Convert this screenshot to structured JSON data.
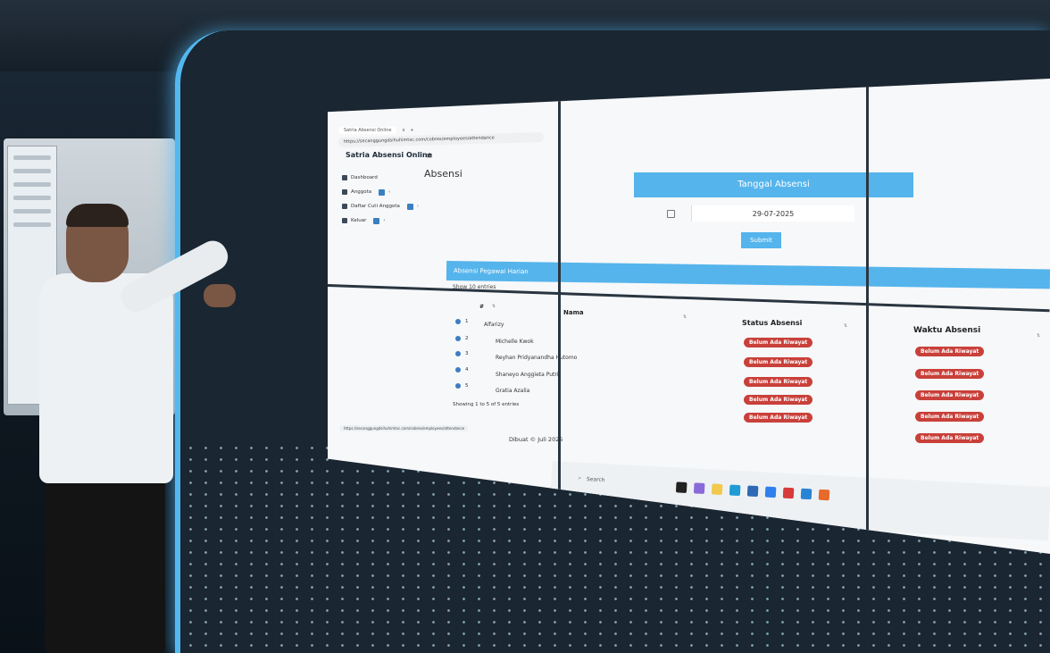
{
  "browser": {
    "tab_label": "Satria Absensi Online",
    "new_tab": "+",
    "close": "x",
    "url": "https://secanggungdsihuhimtxc.com/cobrex/employees/attendance"
  },
  "sidebar": {
    "brand": "Satria Absensi Online",
    "items": [
      {
        "label": "Dashboard"
      },
      {
        "label": "Anggota"
      },
      {
        "label": "Daftar Cuti Anggota"
      },
      {
        "label": "Keluar"
      }
    ]
  },
  "header": {
    "menu_icon": "≡",
    "page_title": "Absensi"
  },
  "form": {
    "title": "Tanggal Absensi",
    "date_value": "29-07-2025",
    "submit_label": "Submit"
  },
  "table": {
    "title": "Absensi Pegawai Harian",
    "show_prefix": "Show",
    "show_value": "10",
    "show_suffix": "entries",
    "columns": {
      "no": "#",
      "nama": "Nama",
      "status": "Status Absensi",
      "waktu": "Waktu Absensi"
    },
    "rows": [
      {
        "no": "1",
        "name": "Alfarizy",
        "status": "Belum Ada Riwayat",
        "waktu": "Belum Ada Riwayat"
      },
      {
        "no": "2",
        "name": "Michelle Kwok",
        "status": "Belum Ada Riwayat",
        "waktu": "Belum Ada Riwayat"
      },
      {
        "no": "3",
        "name": "Reyhan Pridyanandha Hutomo",
        "status": "Belum Ada Riwayat",
        "waktu": "Belum Ada Riwayat"
      },
      {
        "no": "4",
        "name": "Shaneyo Anggieta Putri",
        "status": "Belum Ada Riwayat",
        "waktu": "Belum Ada Riwayat"
      },
      {
        "no": "5",
        "name": "Gratia Azalia",
        "status": "Belum Ada Riwayat",
        "waktu": "Belum Ada Riwayat"
      }
    ],
    "showing": "Showing 1 to 5 of 5 entries"
  },
  "footer": {
    "text": "Dibuat © Juli 2025"
  },
  "taskbar": {
    "search_label": "Search"
  },
  "colors": {
    "accent": "#55b4ec",
    "badge": "#c9403a",
    "wall_light": "#53b8f0"
  },
  "icons": [
    "shield-icon",
    "dashboard-icon",
    "users-icon",
    "calendar-icon",
    "logout-icon",
    "hamburger-icon",
    "sort-icon",
    "search-icon"
  ]
}
